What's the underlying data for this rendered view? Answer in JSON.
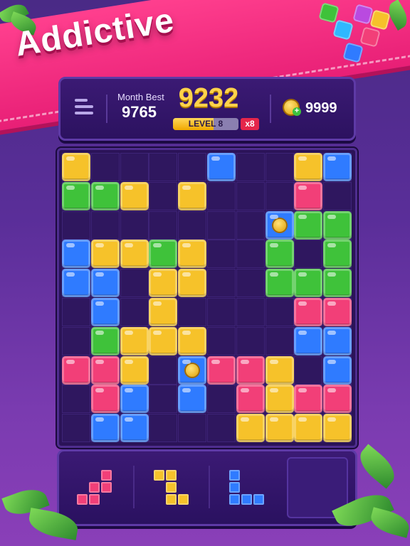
{
  "banner": {
    "title": "Addictive"
  },
  "score_panel": {
    "month_best_label": "Month Best",
    "month_best_value": "9765",
    "score": "9232",
    "level_label": "LEVEL 8",
    "level_progress": 0.62,
    "multiplier": "x8",
    "coins": "9999"
  },
  "colors": {
    "yellow": "#f6c22a",
    "blue": "#2f7bff",
    "pink": "#f23f78",
    "green": "#3fc23a",
    "coin": "#ffd34a",
    "accent": "#e81f76"
  },
  "board": {
    "rows": 10,
    "cols": 10,
    "cells": [
      "Y....B..YB",
      "GGY.Y...P.",
      ".......CGG",
      "BYYGY..G.G",
      "BB.YY..GGG",
      ".B.Y....PP",
      ".GYYY...BB",
      "PPY.CPPY.B",
      ".PB.B.PYPP",
      ".BB...YYYY"
    ],
    "legend": {
      "Y": "yellow",
      "B": "blue",
      "P": "pink",
      "G": "green",
      "C": "coin"
    }
  },
  "tray": {
    "pieces": [
      {
        "color": "pink",
        "shape": [
          "..X",
          ".XX",
          "XX."
        ]
      },
      {
        "color": "yellow",
        "shape": [
          "XX.",
          ".X.",
          ".XX"
        ]
      },
      {
        "color": "blue",
        "shape": [
          "X..",
          "X..",
          "XXX"
        ]
      }
    ],
    "empty_slot": true
  }
}
